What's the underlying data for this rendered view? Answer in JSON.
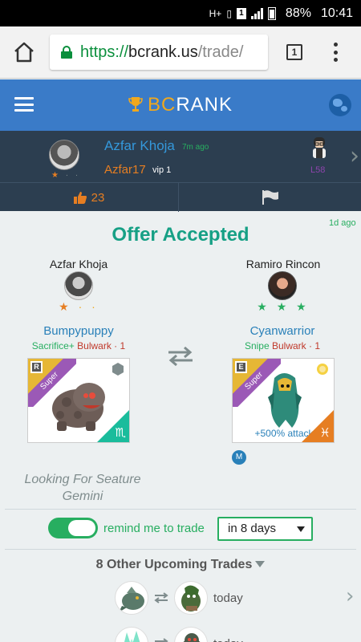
{
  "status_bar": {
    "net_label": "H+",
    "sim_label": "1",
    "battery": "88%",
    "time": "10:41"
  },
  "browser": {
    "url_scheme": "https://",
    "url_host": "bcrank.us",
    "url_path": "/trade/",
    "tab_count": "1"
  },
  "header": {
    "brand_part1": "BC",
    "brand_part2": "RANK",
    "brand_color": "#f0a81e",
    "header_color": "#3a7bc8"
  },
  "poster": {
    "name": "Azfar Khoja",
    "time_ago": "7m ago",
    "username": "Azfar17",
    "vip": "vip 1",
    "level": "L58",
    "stars": "★",
    "stars_dim": "· ·",
    "likes": "23"
  },
  "offer": {
    "time_ago": "1d ago",
    "title": "Offer Accepted",
    "title_color": "#16a085",
    "left": {
      "trader": "Azfar Khoja",
      "stars": "★",
      "stars_dim": "· ·",
      "pet_name": "Bumpypuppy",
      "skill": "Sacrifice+",
      "type": "Bulwark · 1",
      "rarity": "R",
      "ribbon": "Super",
      "sign_glyph": "♏",
      "sign_color": "#1abc9c"
    },
    "right": {
      "trader": "Ramiro Rincon",
      "stars": "★ ★ ★",
      "pet_name": "Cyanwarrior",
      "skill": "Snipe",
      "type": "Bulwark · 1",
      "rarity": "E",
      "ribbon": "Super",
      "sign_glyph": "♓",
      "sign_color": "#e67e22",
      "boost": "+500% attack",
      "badge": "M"
    },
    "looking_for": "Looking For Seature Gemini"
  },
  "reminder": {
    "enabled": true,
    "label": "remind me to trade",
    "selected_option": "in 8 days"
  },
  "upcoming": {
    "title": "8 Other Upcoming Trades",
    "rows": [
      {
        "day": "today"
      },
      {
        "day": "today"
      }
    ]
  }
}
